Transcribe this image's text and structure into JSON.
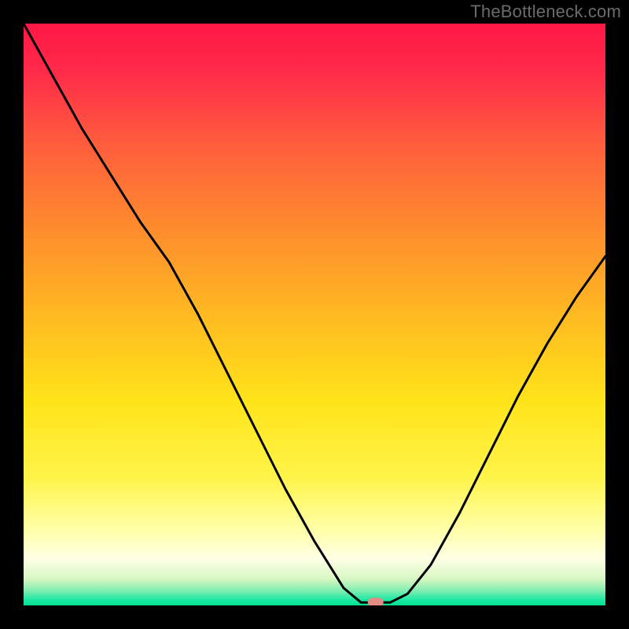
{
  "watermark": "TheBottleneck.com",
  "chart_data": {
    "type": "line",
    "title": "",
    "xlabel": "",
    "ylabel": "",
    "xlim": [
      0,
      100
    ],
    "ylim": [
      0,
      100
    ],
    "series": [
      {
        "name": "bottleneck-curve",
        "x": [
          0,
          5,
          10,
          15,
          20,
          25,
          30,
          35,
          40,
          45,
          50,
          55,
          58,
          60,
          63,
          66,
          70,
          75,
          80,
          85,
          90,
          95,
          100
        ],
        "y": [
          100,
          91,
          82,
          74,
          66,
          59,
          50,
          40,
          30,
          20,
          11,
          3,
          0.5,
          0.5,
          0.5,
          2,
          7,
          16,
          26,
          36,
          45,
          53,
          60
        ]
      }
    ],
    "marker": {
      "x": 60.5,
      "y": 0.5
    },
    "background_gradient": {
      "stops": [
        {
          "offset": 0.0,
          "color": "#ff1744"
        },
        {
          "offset": 0.08,
          "color": "#ff2a4a"
        },
        {
          "offset": 0.2,
          "color": "#ff5a3d"
        },
        {
          "offset": 0.35,
          "color": "#ff8b2e"
        },
        {
          "offset": 0.5,
          "color": "#ffb922"
        },
        {
          "offset": 0.65,
          "color": "#ffe41a"
        },
        {
          "offset": 0.78,
          "color": "#fff44a"
        },
        {
          "offset": 0.87,
          "color": "#ffffa8"
        },
        {
          "offset": 0.92,
          "color": "#ffffe6"
        },
        {
          "offset": 0.955,
          "color": "#d6f7c2"
        },
        {
          "offset": 0.975,
          "color": "#80edb0"
        },
        {
          "offset": 0.99,
          "color": "#1de9a4"
        },
        {
          "offset": 1.0,
          "color": "#00e38f"
        }
      ]
    },
    "marker_color": "#e58b86",
    "curve_color": "#000000"
  }
}
